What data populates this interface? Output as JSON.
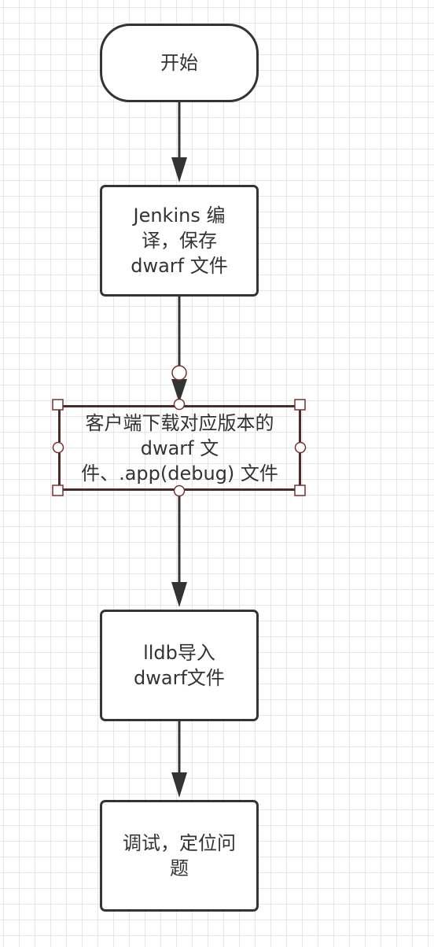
{
  "diagram": {
    "type": "flowchart",
    "nodes": {
      "start": {
        "label": "开始",
        "shape": "terminator"
      },
      "jenkins": {
        "label": "Jenkins 编\n译，保存\ndwarf  文件",
        "shape": "process"
      },
      "client": {
        "label": "客户端下载对应版本的\ndwarf 文\n件、.app(debug) 文件",
        "shape": "process",
        "state": "selected"
      },
      "lldb": {
        "label": "lldb导入\ndwarf文件",
        "shape": "process"
      },
      "debug": {
        "label": "调试，定位问\n题",
        "shape": "process"
      }
    },
    "edges": [
      {
        "from": "start",
        "to": "jenkins"
      },
      {
        "from": "jenkins",
        "to": "client"
      },
      {
        "from": "client",
        "to": "lldb"
      },
      {
        "from": "lldb",
        "to": "debug"
      }
    ],
    "colors": {
      "stroke": "#333333",
      "selection": "#7a2f2f",
      "grid": "#e6e6e6",
      "background": "#ffffff"
    }
  }
}
